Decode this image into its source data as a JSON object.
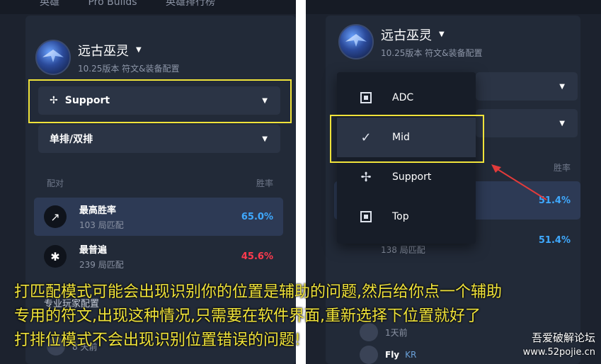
{
  "tabs": [
    "英雄",
    "Pro Builds",
    "英雄排行榜"
  ],
  "left": {
    "champion": {
      "name": "远古巫灵",
      "subtitle": "10.25版本 符文&装备配置"
    },
    "role_select": {
      "label": "Support"
    },
    "queue_select": {
      "label": "单排/双排"
    },
    "headers": {
      "left": "配对",
      "right": "胜率"
    },
    "rows": [
      {
        "title": "最高胜率",
        "sub": "103 局匹配",
        "rate": "65.0%",
        "icon": "trend-up-icon"
      },
      {
        "title": "最普遍",
        "sub": "239 局匹配",
        "rate": "45.6%",
        "icon": "asterisk-icon"
      }
    ],
    "bottom": {
      "label": "专业玩家配置",
      "time": "8 天前"
    }
  },
  "right": {
    "champion": {
      "name": "远古巫灵",
      "subtitle": "10.25版本 符文&装备配置"
    },
    "headers": {
      "right": "胜率"
    },
    "rates": [
      "51.4%",
      "51.4%"
    ],
    "row_sub": "138 局匹配",
    "player": {
      "time": "1天前",
      "name": "Fly",
      "region": "KR"
    }
  },
  "dropdown": {
    "items": [
      {
        "label": "ADC",
        "icon": "adc-icon",
        "selected": false
      },
      {
        "label": "Mid",
        "icon": "check-icon",
        "selected": true
      },
      {
        "label": "Support",
        "icon": "support-icon",
        "selected": false
      },
      {
        "label": "Top",
        "icon": "top-icon",
        "selected": false
      }
    ]
  },
  "caption": {
    "line1": "打匹配模式可能会出现识别你的位置是辅助的问题,然后给你点一个辅助",
    "line2": "专用的符文,出现这种情况,只需要在软件界面,重新选择下位置就好了",
    "line3": "打排位模式不会出现识别位置错误的问题!"
  },
  "watermark": {
    "line1": "吾爱破解论坛",
    "line2": "www.52pojie.cn"
  },
  "colors": {
    "highlight": "#f0e33a",
    "rate_blue": "#3fa9ff",
    "rate_red": "#ff3b4e",
    "arrow": "#e23b3b"
  }
}
